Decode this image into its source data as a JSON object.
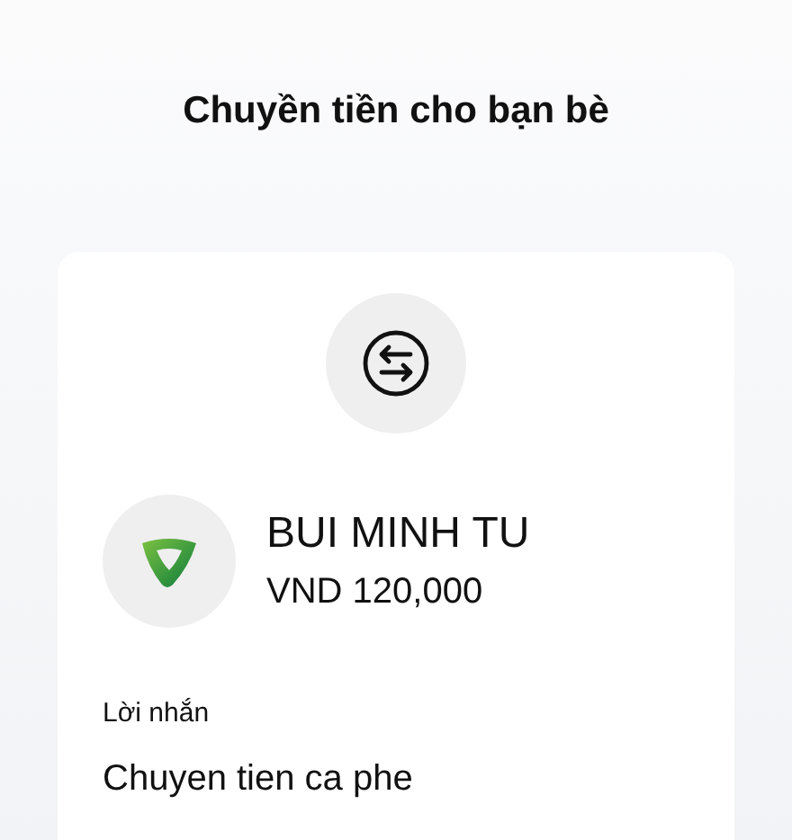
{
  "title": "Chuyền tiền cho bạn bè",
  "recipient": {
    "name": "BUI MINH TU",
    "amount": "VND 120,000"
  },
  "message": {
    "label": "Lời nhắn",
    "text": "Chuyen tien ca phe"
  }
}
